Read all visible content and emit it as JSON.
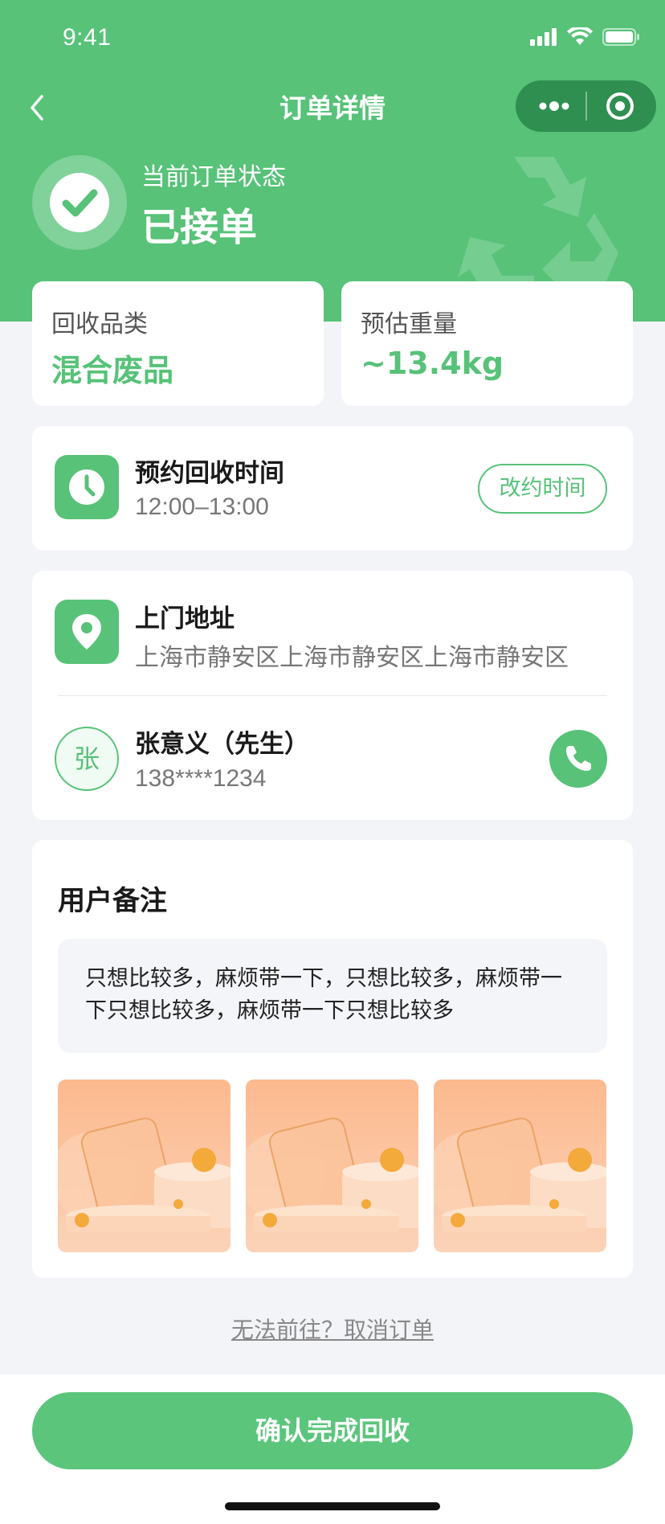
{
  "status_bar": {
    "time": "9:41"
  },
  "nav": {
    "title": "订单详情"
  },
  "order_status": {
    "label": "当前订单状态",
    "value": "已接单"
  },
  "info_cards": [
    {
      "label": "回收品类",
      "value": "混合废品"
    },
    {
      "label": "预估重量",
      "value": "~13.4kg"
    }
  ],
  "schedule": {
    "title": "预约回收时间",
    "time": "12:00–13:00",
    "reschedule_label": "改约时间"
  },
  "address": {
    "title": "上门地址",
    "value": "上海市静安区上海市静安区上海市静安区"
  },
  "contact": {
    "avatar_char": "张",
    "name": "张意义（先生）",
    "phone": "138****1234"
  },
  "notes": {
    "title": "用户备注",
    "text": "只想比较多，麻烦带一下，只想比较多，麻烦带一下只想比较多，麻烦带一下只想比较多"
  },
  "cancel_link": "无法前往？取消订单",
  "confirm_button": "确认完成回收",
  "colors": {
    "primary": "#57c278",
    "capsule": "#2f8f51",
    "background": "#f3f4f8"
  }
}
